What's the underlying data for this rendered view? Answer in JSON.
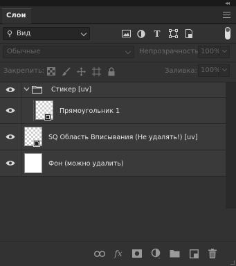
{
  "panel": {
    "tab_label": "Слои",
    "collapse_glyph": "◂◂"
  },
  "filter": {
    "kind_label": "Вид",
    "icons": [
      "image-filter-icon",
      "adjustment-filter-icon",
      "type-filter-icon",
      "shape-filter-icon",
      "smart-object-filter-icon"
    ],
    "type_glyph": "T"
  },
  "blend": {
    "mode": "Обычные",
    "opacity_label": "Непрозрачность:",
    "opacity_value": "100%"
  },
  "lock": {
    "label": "Закрепить:",
    "icons": [
      "lock-transparent-icon",
      "lock-image-icon",
      "lock-position-icon",
      "lock-artboard-icon",
      "lock-all-icon"
    ],
    "fill_label": "Заливка:",
    "fill_value": "100%"
  },
  "layers": [
    {
      "name": "Стикер [uv]",
      "kind": "group",
      "visible": true,
      "expanded": true
    },
    {
      "name": "Прямоугольник 1",
      "kind": "shape",
      "visible": true
    },
    {
      "name": "SQ Область Вписывания (Не удалять!) [uv]",
      "kind": "smart-object",
      "visible": true
    },
    {
      "name": "Фон (можно удалить)",
      "kind": "background",
      "visible": true
    }
  ],
  "bottom_icons": [
    "link-layers-icon",
    "layer-style-icon",
    "add-mask-icon",
    "adjustment-layer-icon",
    "new-group-icon",
    "new-layer-icon",
    "delete-layer-icon"
  ],
  "fx_glyph": "fx",
  "colors": {
    "panel_bg": "#323232",
    "layer_row": "#3a3a3a",
    "text": "#e6e6e6",
    "dim_text": "#6a6a6a"
  }
}
